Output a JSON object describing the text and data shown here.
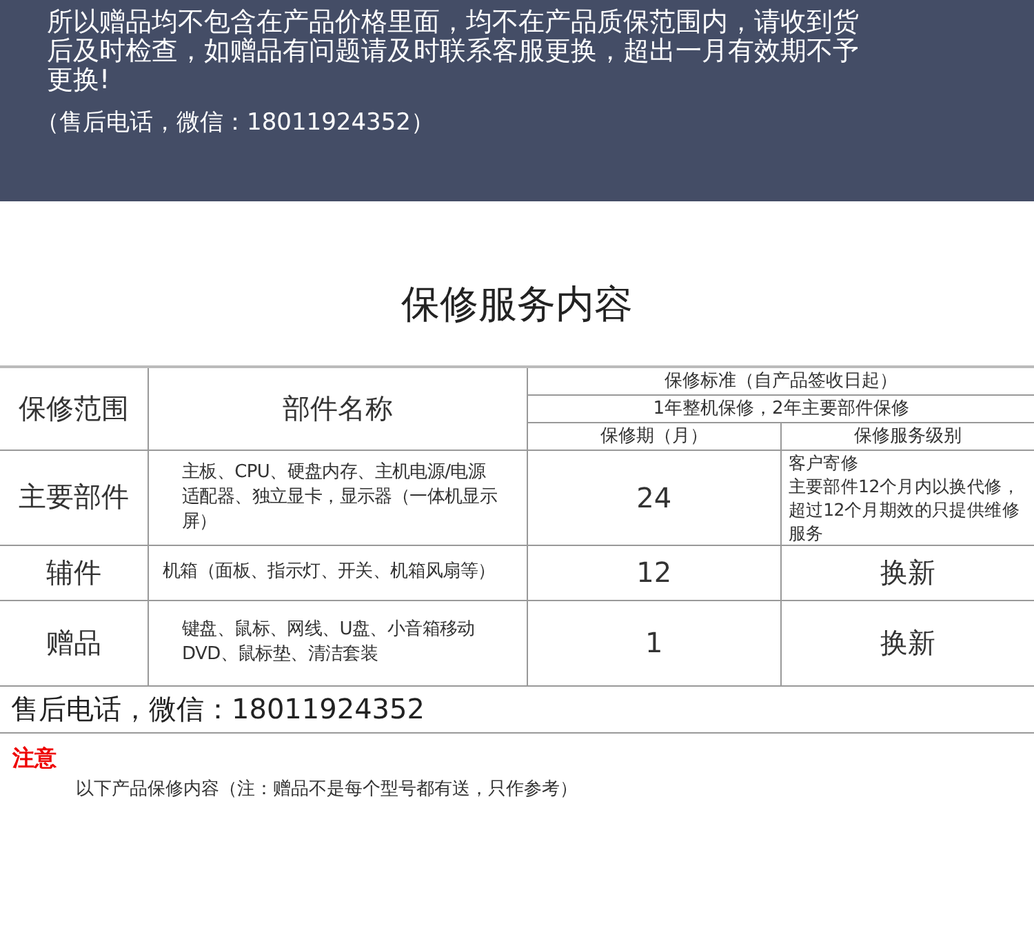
{
  "banner": {
    "notice": "所以赠品均不包含在产品价格里面，均不在产品质保范围内，请收到货后及时检查，如赠品有问题请及时联系客服更换，超出一月有效期不予更换!",
    "contact": "（售后电话，微信：18011924352）"
  },
  "title": "保修服务内容",
  "table": {
    "scope_header": "保修范围",
    "parts_header": "部件名称",
    "standard_header": "保修标准（自产品签收日起）",
    "standard_summary": "1年整机保修，2年主要部件保修",
    "period_header": "保修期（月）",
    "level_header": "保修服务级别",
    "rows": [
      {
        "scope": "主要部件",
        "parts": "主板、CPU、硬盘内存、主机电源/电源适配器、独立显卡，显示器（一体机显示屏）",
        "period": "24",
        "service_lines": [
          "客户寄修",
          "主要部件12个月内以换代修，超过12个月期效的只提供维修服务"
        ],
        "kind": "text"
      },
      {
        "scope": "辅件",
        "parts": "机箱（面板、指示灯、开关、机箱风扇等）",
        "period": "12",
        "service": "换新",
        "kind": "big"
      },
      {
        "scope": "赠品",
        "parts": "键盘、鼠标、网线、U盘、小音箱移动DVD、鼠标垫、清洁套装",
        "period": "1",
        "service": "换新",
        "kind": "big"
      }
    ]
  },
  "contact": "售后电话，微信：18011924352",
  "note": {
    "heading": "注意",
    "text": "以下产品保修内容（注：赠品不是每个型号都有送，只作参考）"
  }
}
